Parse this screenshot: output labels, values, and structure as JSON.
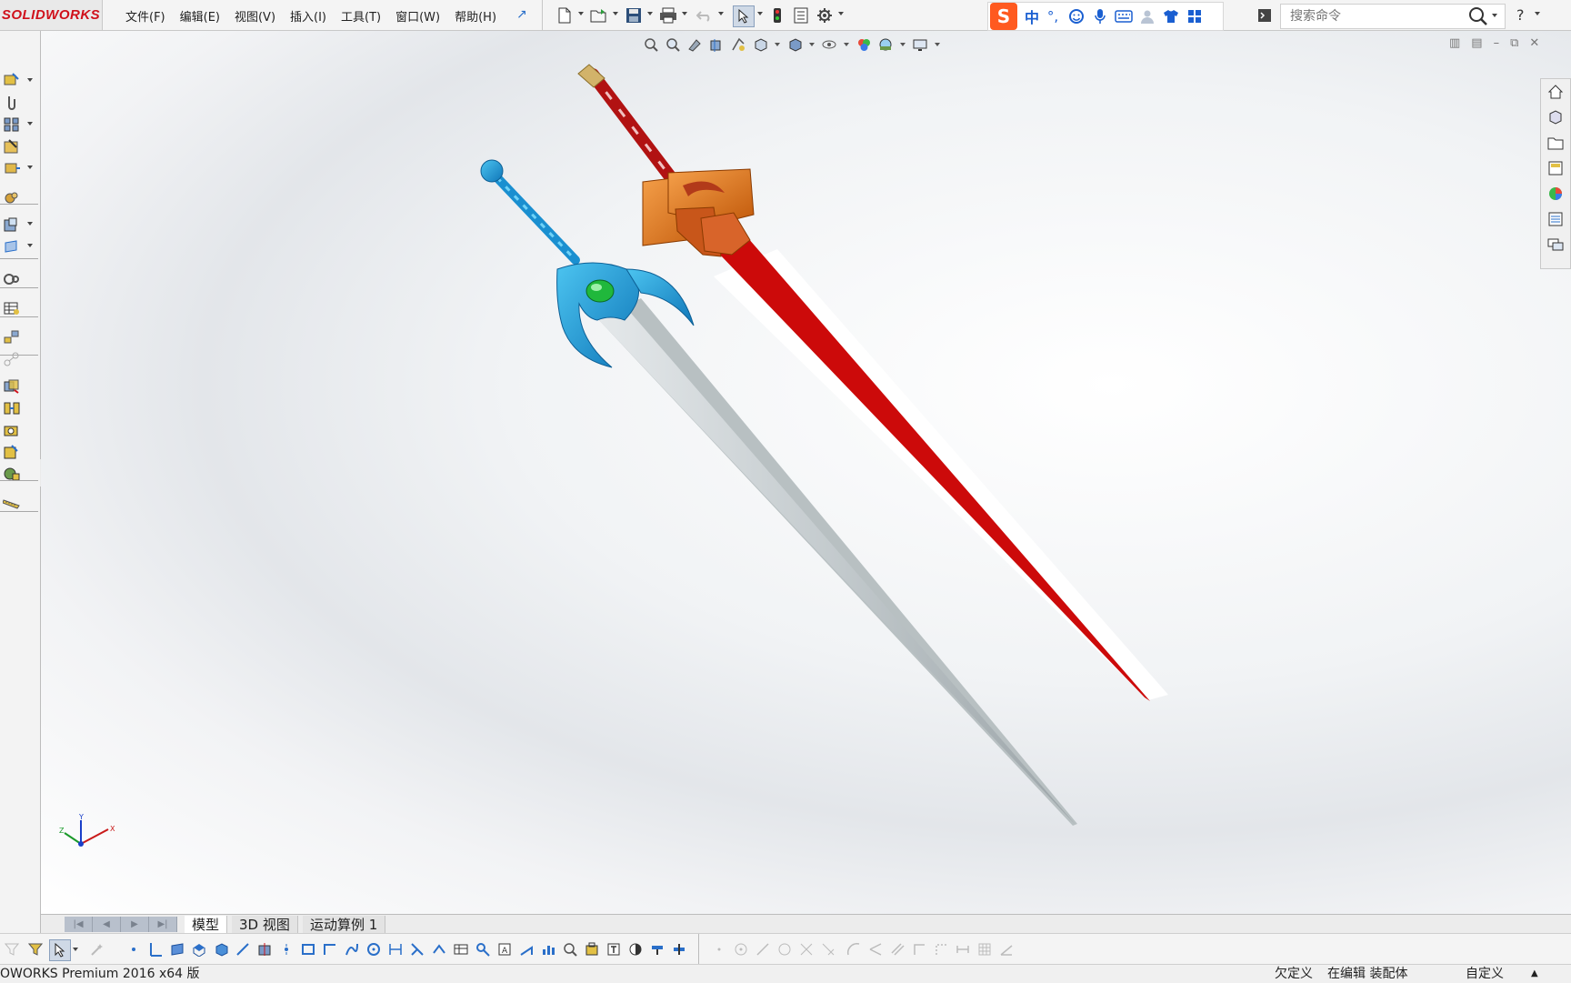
{
  "app": {
    "logo_text": "SOLIDWORKS",
    "brand_color": "#d0111b"
  },
  "menu": [
    "文件(F)",
    "编辑(E)",
    "视图(V)",
    "插入(I)",
    "工具(T)",
    "窗口(W)",
    "帮助(H)"
  ],
  "ime": {
    "logo": "S",
    "mode": "中",
    "punct": "°,"
  },
  "search": {
    "placeholder": "搜索命令"
  },
  "help": {
    "label": "?"
  },
  "tabs": {
    "model": "模型",
    "view3d": "3D 视图",
    "motion": "运动算例 1"
  },
  "status": {
    "product": "OWORKS Premium 2016 x64 版",
    "definition": "欠定义",
    "editing": "在编辑 装配体",
    "custom": "自定义"
  },
  "triad": {
    "x": "X",
    "y": "Y",
    "z": "Z"
  },
  "model": {
    "blue_sword_color": "#1e9fd8",
    "gem_color": "#28c84a",
    "red_sword_color": "#cc0a0a",
    "guard_color": "#e27a1e",
    "blade_color": "#c9cfd2"
  }
}
